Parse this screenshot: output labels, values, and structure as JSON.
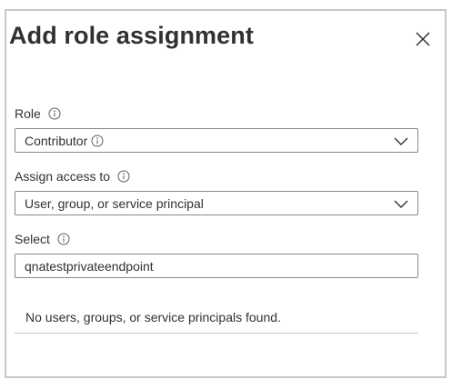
{
  "dialog": {
    "title": "Add role assignment",
    "close_icon": "close-icon"
  },
  "role": {
    "label": "Role",
    "info_icon": "info-icon",
    "selected": "Contributor"
  },
  "assign_access": {
    "label": "Assign access to",
    "info_icon": "info-icon",
    "selected": "User, group, or service principal"
  },
  "select": {
    "label": "Select",
    "info_icon": "info-icon",
    "value": "qnatestprivateendpoint"
  },
  "results": {
    "empty_message": "No users, groups, or service principals found."
  }
}
